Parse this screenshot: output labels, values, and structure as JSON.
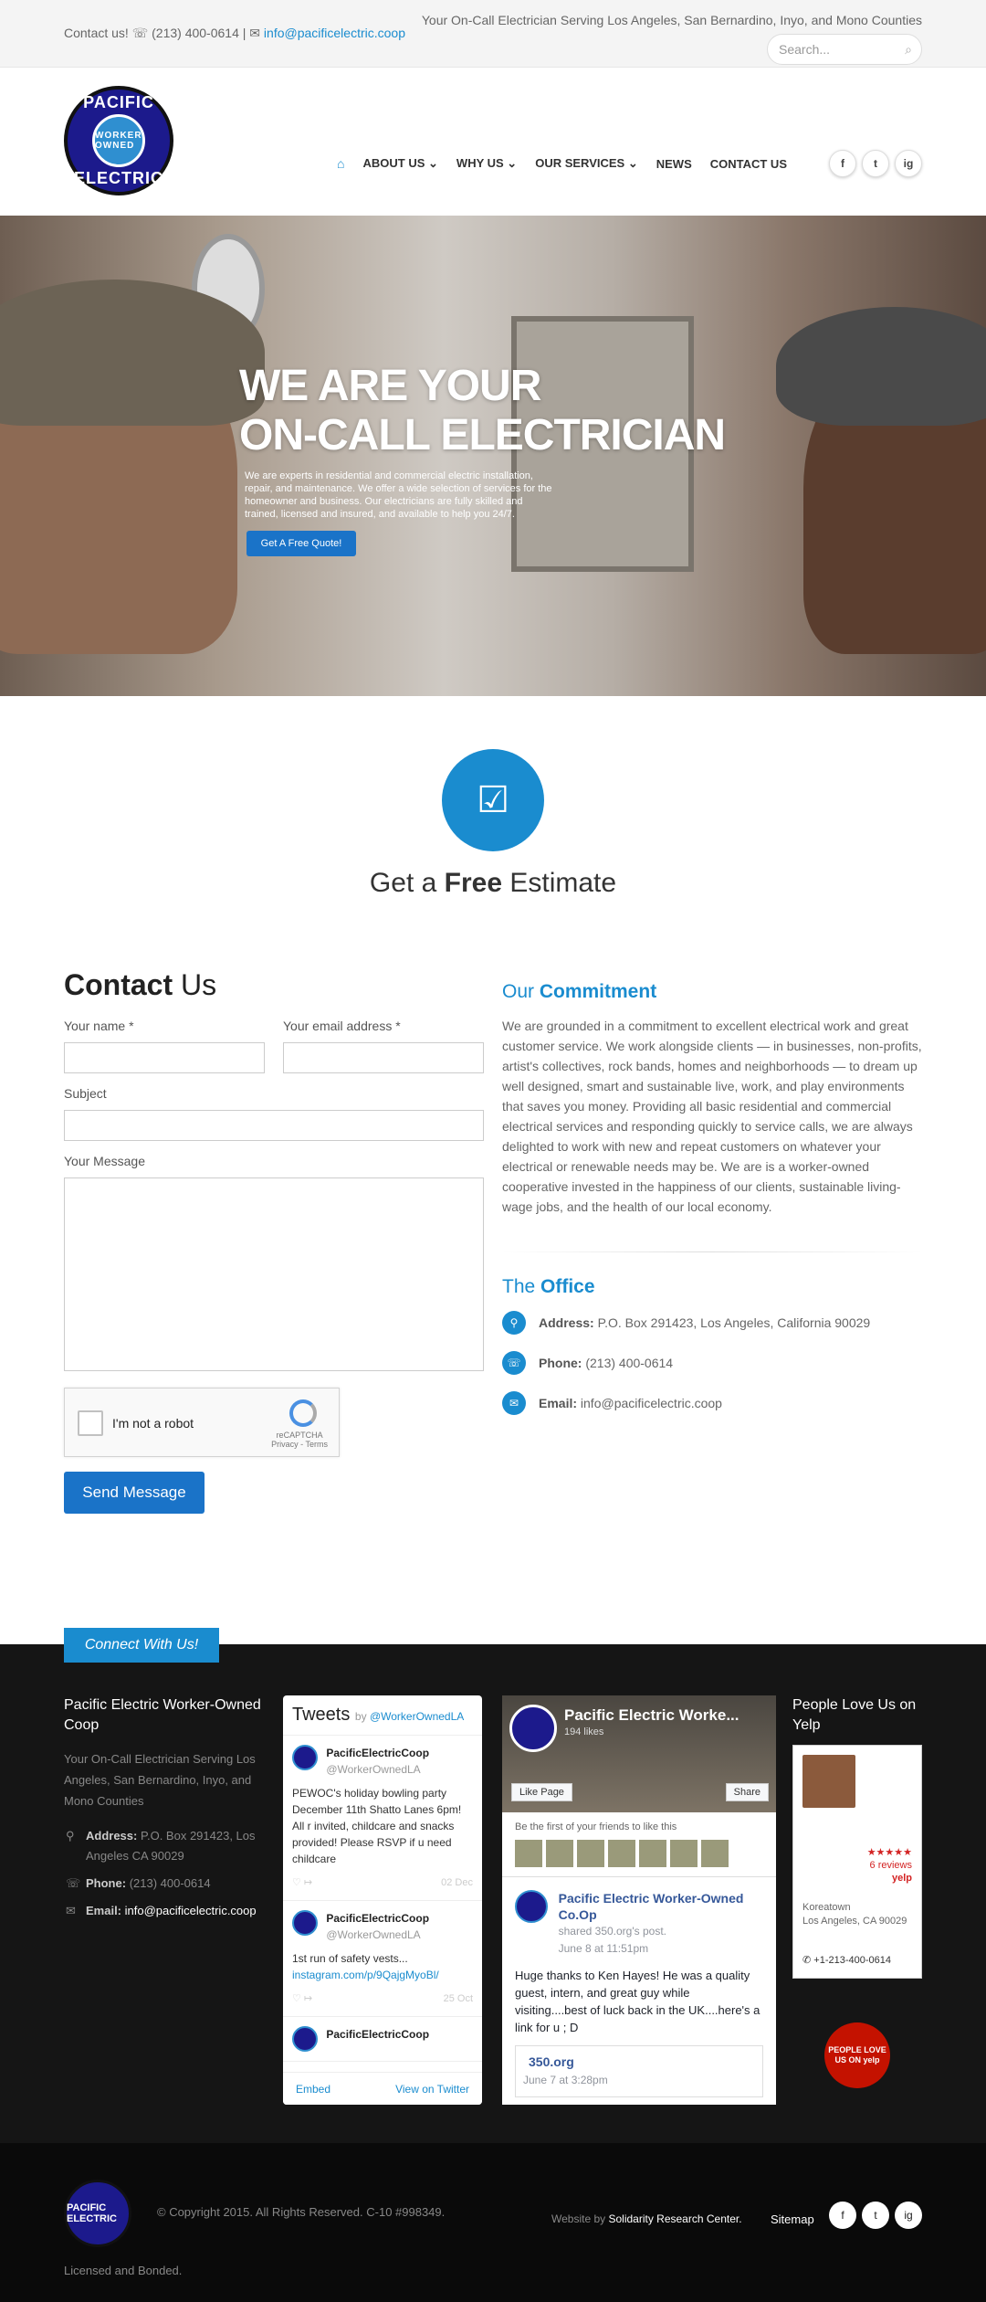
{
  "topbar": {
    "contact_label": "Contact us!",
    "phone": "(213) 400-0614",
    "email": "info@pacificelectric.coop",
    "tagline": "Your On-Call Electrician Serving Los Angeles, San Bernardino, Inyo, and Mono Counties",
    "search_placeholder": "Search..."
  },
  "logo": {
    "top": "PACIFIC",
    "inner": "WORKER OWNED",
    "bottom": "ELECTRIC"
  },
  "nav": {
    "items": [
      "ABOUT US",
      "WHY US",
      "OUR SERVICES",
      "NEWS",
      "CONTACT US"
    ],
    "home_icon": "home-icon",
    "social": [
      "f",
      "t",
      "ig"
    ]
  },
  "hero": {
    "title_line1": "WE ARE YOUR",
    "title_line2": "ON-CALL ELECTRICIAN",
    "body": "We are experts in residential and commercial electric installation, repair, and maintenance. We offer a wide selection of services for the homeowner and business. Our electricians are fully skilled and trained, licensed and insured, and available to help you 24/7.",
    "button": "Get A Free Quote!"
  },
  "estimate": {
    "pre": "Get a ",
    "bold": "Free",
    "post": " Estimate"
  },
  "contact": {
    "title_bold": "Contact",
    "title_rest": " Us",
    "name_label": "Your name *",
    "email_label": "Your email address *",
    "subject_label": "Subject",
    "message_label": "Your Message",
    "captcha_label": "I'm not a robot",
    "captcha_brand": "reCAPTCHA",
    "captcha_links": "Privacy - Terms",
    "send": "Send Message"
  },
  "commitment": {
    "title_pre": "Our ",
    "title_bold": "Commitment",
    "body": "We are grounded in a commitment to excellent electrical work and great customer service. We work alongside clients — in businesses, non-profits, artist's collectives, rock bands, homes and neighborhoods — to dream up well designed, smart and sustainable live, work, and play environments that saves you money. Providing all basic residential and commercial electrical services and responding quickly to service calls, we are always delighted to work with new and repeat customers on whatever your electrical or renewable needs may be. We are is a worker-owned cooperative invested in the happiness of our clients, sustainable living-wage jobs, and the health of our local economy."
  },
  "office": {
    "title_pre": "The ",
    "title_bold": "Office",
    "address_label": "Address:",
    "address": "P.O. Box 291423, Los Angeles, California 90029",
    "phone_label": "Phone:",
    "phone": "(213) 400-0614",
    "email_label": "Email:",
    "email": "info@pacificelectric.coop"
  },
  "footer": {
    "connect": "Connect With Us!",
    "company": "Pacific Electric Worker-Owned Coop",
    "tagline": "Your On-Call Electrician Serving Los Angeles, San Bernardino, Inyo, and Mono Counties",
    "address_label": "Address:",
    "address": "P.O. Box 291423, Los Angeles CA 90029",
    "phone_label": "Phone:",
    "phone": "(213) 400-0614",
    "email_label": "Email:",
    "email": "info@pacificelectric.coop"
  },
  "tweets": {
    "title": "Tweets",
    "by": "by ",
    "handle": "@WorkerOwnedLA",
    "items": [
      {
        "name": "PacificElectricCoop",
        "handle": "@WorkerOwnedLA",
        "text": "PEWOC's holiday bowling party December 11th Shatto Lanes 6pm! All r invited, childcare and snacks provided! Please RSVP if u need childcare",
        "link": "",
        "date": "02 Dec"
      },
      {
        "name": "PacificElectricCoop",
        "handle": "@WorkerOwnedLA",
        "text": "1st run of safety vests...",
        "link": "instagram.com/p/9QajgMyoBl/",
        "date": "25 Oct"
      },
      {
        "name": "PacificElectricCoop",
        "handle": "",
        "text": "",
        "link": "",
        "date": ""
      }
    ],
    "embed": "Embed",
    "view": "View on Twitter"
  },
  "facebook": {
    "page": "Pacific Electric Worke...",
    "likes": "194 likes",
    "like_btn": "Like Page",
    "share_btn": "Share",
    "friends": "Be the first of your friends to like this",
    "post_author": "Pacific Electric Worker-Owned Co.Op",
    "post_shared": "shared 350.org's post.",
    "post_date": "June 8 at 11:51pm",
    "post_text": "Huge thanks to Ken Hayes! He was a quality guest, intern, and great guy while visiting....best of luck back in the UK....here's a link for u ; D",
    "link_title": "350.org",
    "link_date": "June 7 at 3:28pm"
  },
  "yelp": {
    "title": "People Love Us on Yelp",
    "reviews": "6 reviews",
    "brand": "yelp",
    "location": "Koreatown",
    "city": "Los Angeles, CA 90029",
    "phone": "+1-213-400-0614",
    "badge": "PEOPLE LOVE US ON yelp"
  },
  "bottom": {
    "copyright": "© Copyright 2015. All Rights Reserved. C-10 #998349.",
    "website_by": "Website by ",
    "builder": "Solidarity Research Center.",
    "sitemap": "Sitemap",
    "license": "Licensed and Bonded."
  }
}
